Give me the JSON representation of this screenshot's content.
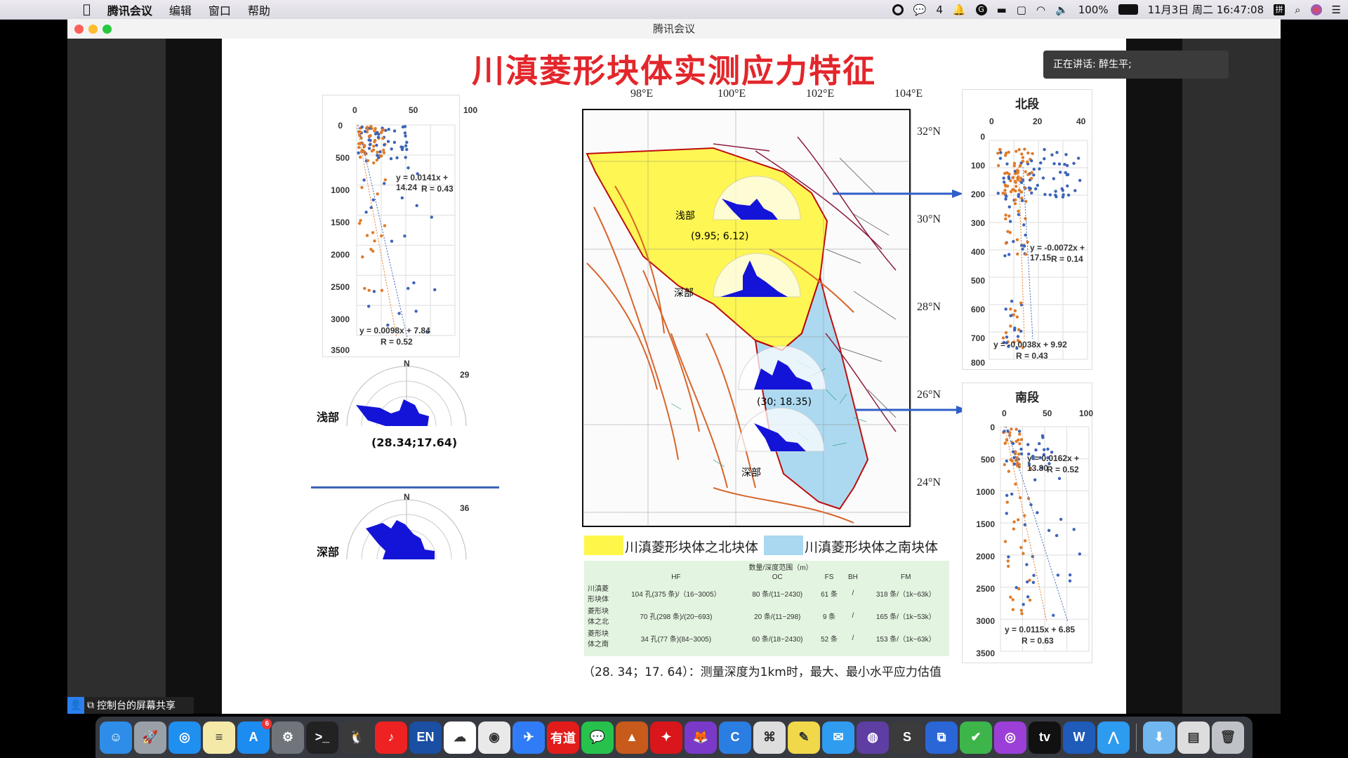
{
  "menubar": {
    "apple": "",
    "app_name": "腾讯会议",
    "items": [
      "编辑",
      "窗口",
      "帮助"
    ],
    "wechat_count": "4",
    "battery": "100%",
    "datetime": "11月3日 周二  16:47:08"
  },
  "window": {
    "title": "腾讯会议",
    "speaking": "正在讲话: 醉生平;",
    "share_label": "控制台的屏幕共享"
  },
  "slide": {
    "title": "川滇菱形块体实测应力特征",
    "left_scatter": {
      "x_ticks": [
        "0",
        "50",
        "100"
      ],
      "y_ticks": [
        "0",
        "500",
        "1000",
        "1500",
        "2000",
        "2500",
        "3000",
        "3500"
      ],
      "eq1": "y = 0.0141x + 14.24",
      "r1": "R = 0.43",
      "eq2": "y = 0.0098x + 7.84",
      "r2": "R = 0.52"
    },
    "rose_shallow": {
      "label": "浅部",
      "north": "N",
      "max": "29",
      "coords": "(28.34;17.64)"
    },
    "rose_deep": {
      "label": "深部",
      "north": "N",
      "max": "36"
    },
    "map": {
      "lon_ticks": [
        "98°E",
        "100°E",
        "102°E",
        "104°E"
      ],
      "lat_ticks": [
        "32°N",
        "30°N",
        "28°N",
        "26°N",
        "24°N"
      ],
      "labels": {
        "shallow_north": "浅部",
        "deep_north": "深部",
        "coord_north": "(9.95; 6.12)",
        "coord_south": "(30; 18.35)",
        "deep_south": "深部"
      }
    },
    "legend": {
      "north_block": "川滇菱形块体之北块体",
      "south_block": "川滇菱形块体之南块体"
    },
    "table": {
      "header_top": "数量/深度范围（m）",
      "columns": [
        "HF",
        "OC",
        "FS",
        "BH",
        "FM"
      ],
      "rows": [
        {
          "name": "川滇菱形块体",
          "cells": [
            "104 孔(375 条)/（16~3005）",
            "80 条/(11~2430)",
            "61 条",
            "/",
            "318 条/（1k~63k）"
          ]
        },
        {
          "name": "菱形块体之北",
          "cells": [
            "70 孔(298 条)/(20~693)",
            "20 条/(11~298)",
            "9 条",
            "/",
            "165 条/（1k~53k）"
          ]
        },
        {
          "name": "菱形块体之南",
          "cells": [
            "34 孔(77 条)(84~3005)",
            "60 条/(18~2430)",
            "52 条",
            "/",
            "153 条/（1k~63k）"
          ]
        }
      ]
    },
    "footnote": "（28. 34；17. 64）：测量深度为1km时，最大、最小水平应力估值",
    "north_panel": {
      "title": "北段",
      "x_ticks": [
        "0",
        "20",
        "40"
      ],
      "y_ticks": [
        "0",
        "100",
        "200",
        "300",
        "400",
        "500",
        "600",
        "700",
        "800"
      ],
      "eq1": "y = -0.0072x + 17.15",
      "r1": "R = 0.14",
      "eq2": "y = -0.0038x + 9.92",
      "r2": "R = 0.43"
    },
    "south_panel": {
      "title": "南段",
      "x_ticks": [
        "0",
        "50",
        "100"
      ],
      "y_ticks": [
        "0",
        "500",
        "1000",
        "1500",
        "2000",
        "2500",
        "3000",
        "3500"
      ],
      "eq1": "y = 0.0162x + 13.80",
      "r1": "R = 0.52",
      "eq2": "y = 0.0115x + 6.85",
      "r2": "R = 0.63"
    }
  },
  "colors": {
    "orange": "#e07b2a",
    "blue": "#3d64b8",
    "north_block": "#fff64a",
    "south_block": "#a9d8f0",
    "rose": "#1414d8",
    "title_red": "#e3262b"
  },
  "dock": {
    "items": [
      {
        "name": "finder-icon",
        "glyph": "☺",
        "bg": "#2d8de8"
      },
      {
        "name": "launchpad-icon",
        "glyph": "🚀",
        "bg": "#9aa0a8"
      },
      {
        "name": "safari-icon",
        "glyph": "◎",
        "bg": "#1f8ff0"
      },
      {
        "name": "notes-icon",
        "glyph": "≡",
        "bg": "#f5e9a8"
      },
      {
        "name": "app-store-icon",
        "glyph": "A",
        "bg": "#1d8cf0",
        "badge": "6"
      },
      {
        "name": "system-preferences-icon",
        "glyph": "⚙",
        "bg": "#70757c"
      },
      {
        "name": "terminal-icon",
        "glyph": ">_",
        "bg": "#222"
      },
      {
        "name": "qq-icon",
        "glyph": "🐧",
        "bg": "#3a3a3a"
      },
      {
        "name": "netease-music-icon",
        "glyph": "♪",
        "bg": "#e22"
      },
      {
        "name": "en-dictionary-icon",
        "glyph": "EN",
        "bg": "#1a4fa3"
      },
      {
        "name": "baidu-netdisk-icon",
        "glyph": "☁",
        "bg": "#fff"
      },
      {
        "name": "chrome-icon",
        "glyph": "◉",
        "bg": "#e9e9e9"
      },
      {
        "name": "lark-icon",
        "glyph": "✈",
        "bg": "#2f7cf6"
      },
      {
        "name": "youdao-icon",
        "glyph": "有道",
        "bg": "#e21b1b"
      },
      {
        "name": "wechat-icon",
        "glyph": "💬",
        "bg": "#27c24c"
      },
      {
        "name": "matlab-icon",
        "glyph": "▲",
        "bg": "#c85a1b"
      },
      {
        "name": "acrobat-icon",
        "glyph": "✦",
        "bg": "#d8161b"
      },
      {
        "name": "firefox-icon",
        "glyph": "🦊",
        "bg": "#7b39c9"
      },
      {
        "name": "c-app-icon",
        "glyph": "C",
        "bg": "#2a7de1"
      },
      {
        "name": "screenshot-icon",
        "glyph": "⌘",
        "bg": "#ddd"
      },
      {
        "name": "stickies-icon",
        "glyph": "✎",
        "bg": "#f0d84a"
      },
      {
        "name": "tencent-meeting-icon",
        "glyph": "✉",
        "bg": "#2f9cf0"
      },
      {
        "name": "github-icon",
        "glyph": "◍",
        "bg": "#5e3ea3"
      },
      {
        "name": "sublime-icon",
        "glyph": "S",
        "bg": "#3b3b3b"
      },
      {
        "name": "remote-icon",
        "glyph": "⧉",
        "bg": "#2b66d6"
      },
      {
        "name": "tasks-icon",
        "glyph": "✔",
        "bg": "#3db54a"
      },
      {
        "name": "podcasts-icon",
        "glyph": "◎",
        "bg": "#9c3fd8"
      },
      {
        "name": "apple-tv-icon",
        "glyph": "tv",
        "bg": "#111"
      },
      {
        "name": "word-icon",
        "glyph": "W",
        "bg": "#1f5bb8"
      },
      {
        "name": "voov-icon",
        "glyph": "⋀",
        "bg": "#2d9bf0"
      },
      {
        "name": "downloads-folder-icon",
        "glyph": "⬇",
        "bg": "#6fb7ee"
      },
      {
        "name": "documents-icon",
        "glyph": "▤",
        "bg": "#ddd"
      },
      {
        "name": "trash-icon",
        "glyph": "🗑",
        "bg": "#bfc3c8"
      }
    ]
  }
}
